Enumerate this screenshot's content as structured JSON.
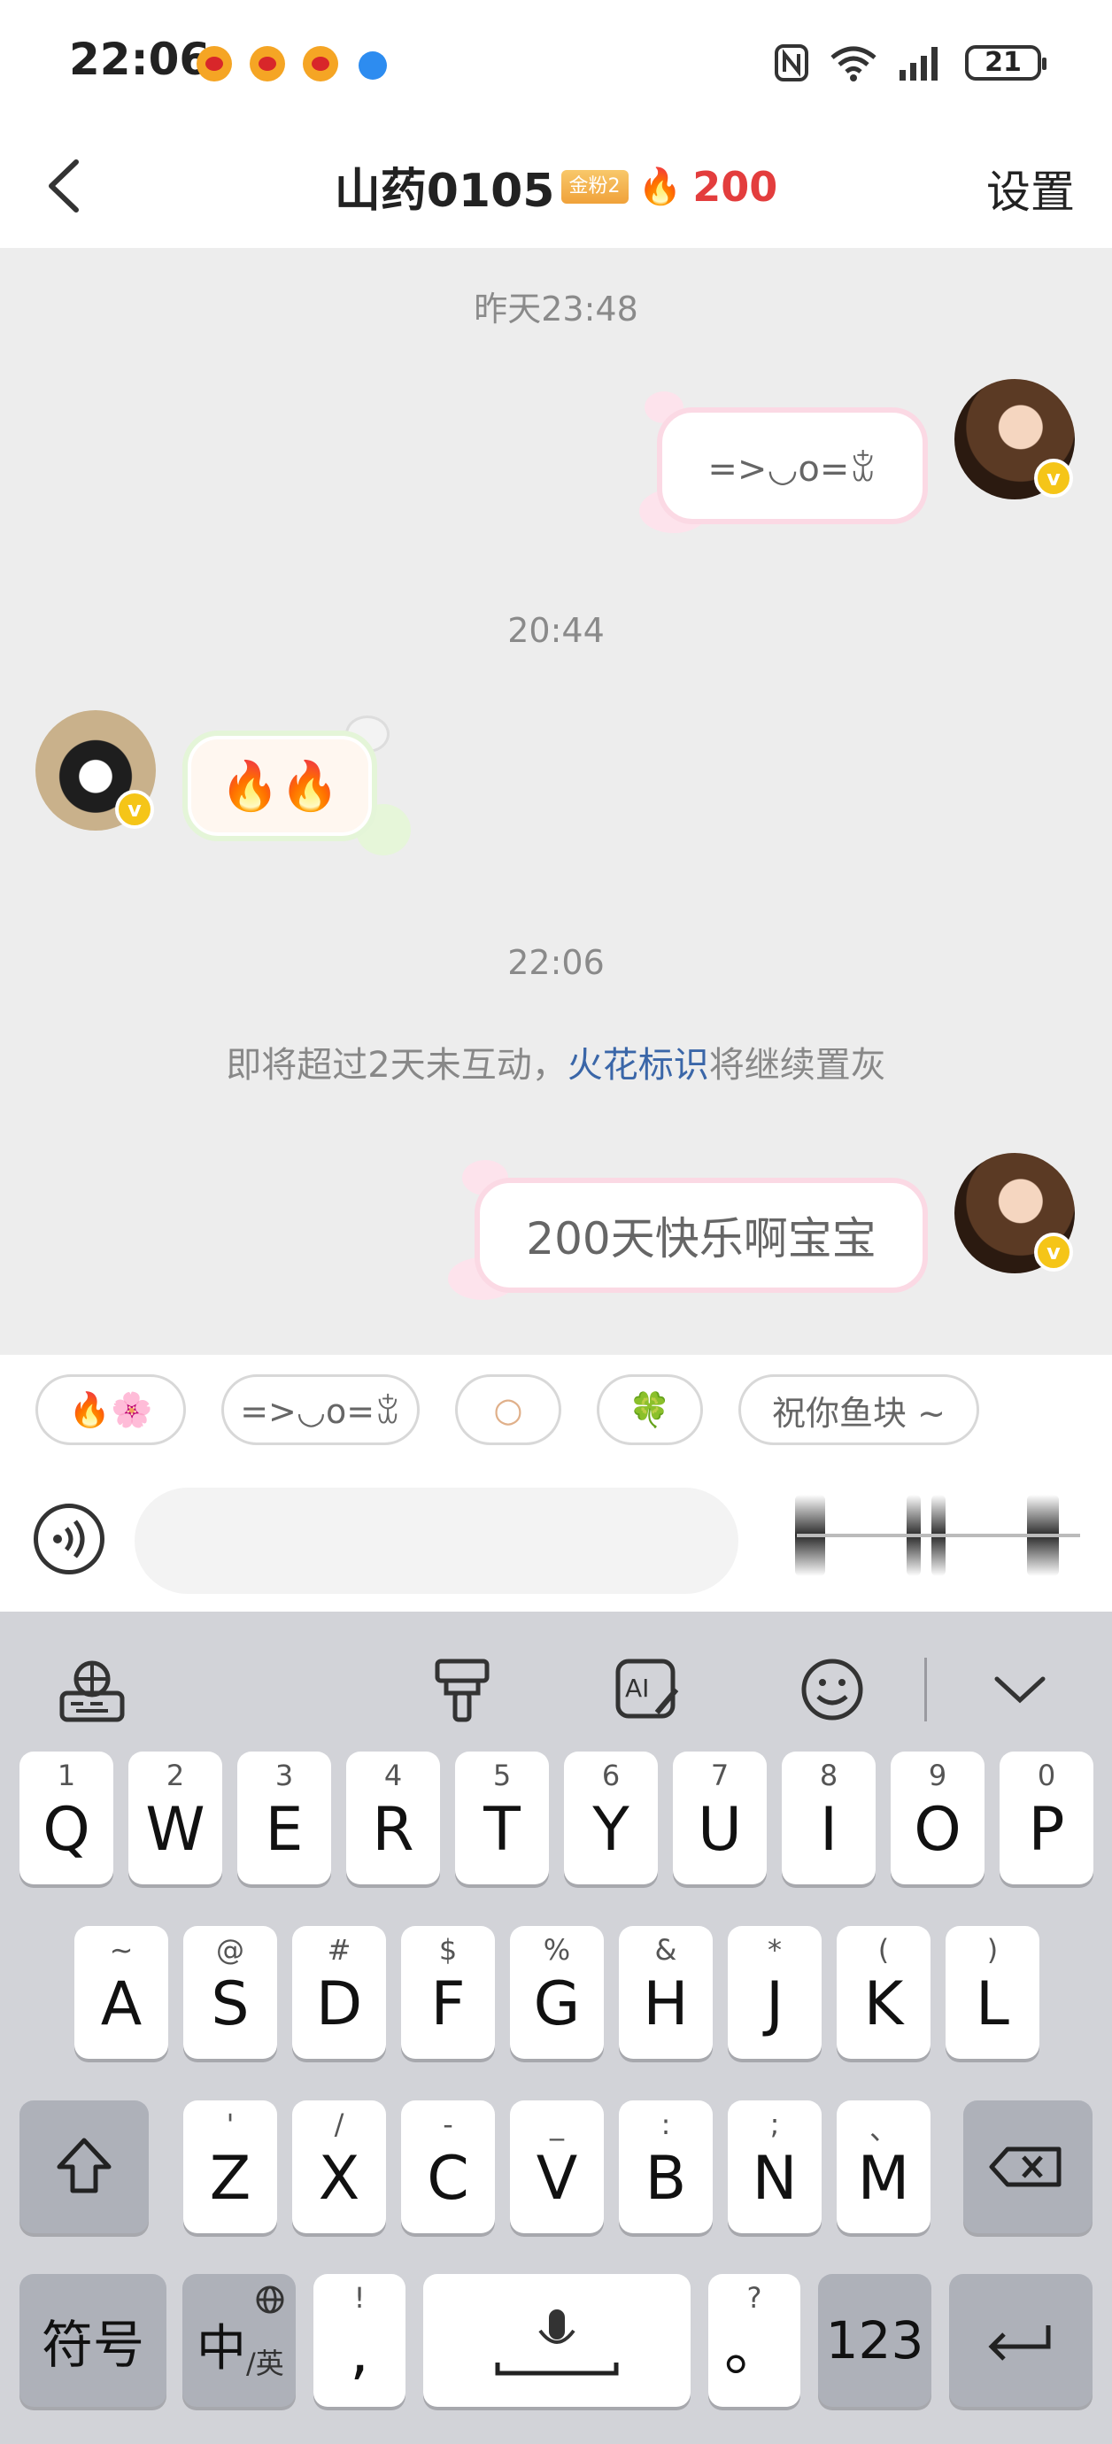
{
  "status": {
    "time": "22:06",
    "battery": "21"
  },
  "header": {
    "title": "山药0105",
    "fan_badge": "金粉2",
    "fire_emoji": "🔥",
    "fire_count": "200",
    "settings": "设置"
  },
  "chat": {
    "timestamps": [
      "昨天23:48",
      "20:44",
      "22:06"
    ],
    "messages": [
      {
        "text": "=>◡o=ꒃ"
      },
      {
        "text": "🔥🔥"
      },
      {
        "text": "200天快乐啊宝宝"
      }
    ],
    "system_notice": {
      "prefix": "即将超过2天未互动，",
      "link": "火花标识",
      "suffix": "将继续置灰"
    },
    "verified_mark": "v"
  },
  "quick_replies": [
    "🔥🌸",
    "=>◡o=ꒃ",
    "○",
    "🍀",
    "祝你鱼块 ~"
  ],
  "input": {
    "placeholder": ""
  },
  "keyboard": {
    "row1": [
      {
        "k": "Q",
        "h": "1"
      },
      {
        "k": "W",
        "h": "2"
      },
      {
        "k": "E",
        "h": "3"
      },
      {
        "k": "R",
        "h": "4"
      },
      {
        "k": "T",
        "h": "5"
      },
      {
        "k": "Y",
        "h": "6"
      },
      {
        "k": "U",
        "h": "7"
      },
      {
        "k": "I",
        "h": "8"
      },
      {
        "k": "O",
        "h": "9"
      },
      {
        "k": "P",
        "h": "0"
      }
    ],
    "row2": [
      {
        "k": "A",
        "h": "~"
      },
      {
        "k": "S",
        "h": "@"
      },
      {
        "k": "D",
        "h": "#"
      },
      {
        "k": "F",
        "h": "$"
      },
      {
        "k": "G",
        "h": "%"
      },
      {
        "k": "H",
        "h": "&"
      },
      {
        "k": "J",
        "h": "*"
      },
      {
        "k": "K",
        "h": "("
      },
      {
        "k": "L",
        "h": ")"
      }
    ],
    "row3": [
      {
        "k": "Z",
        "h": "'"
      },
      {
        "k": "X",
        "h": "/"
      },
      {
        "k": "C",
        "h": "-"
      },
      {
        "k": "V",
        "h": "_"
      },
      {
        "k": "B",
        "h": ":"
      },
      {
        "k": "N",
        "h": ";"
      },
      {
        "k": "M",
        "h": "、"
      }
    ],
    "symbols": "符号",
    "lang_main": "中",
    "lang_sub": "/英",
    "comma": ",",
    "comma_hint": "!",
    "period": "。",
    "period_hint": "?",
    "numbers": "123"
  }
}
